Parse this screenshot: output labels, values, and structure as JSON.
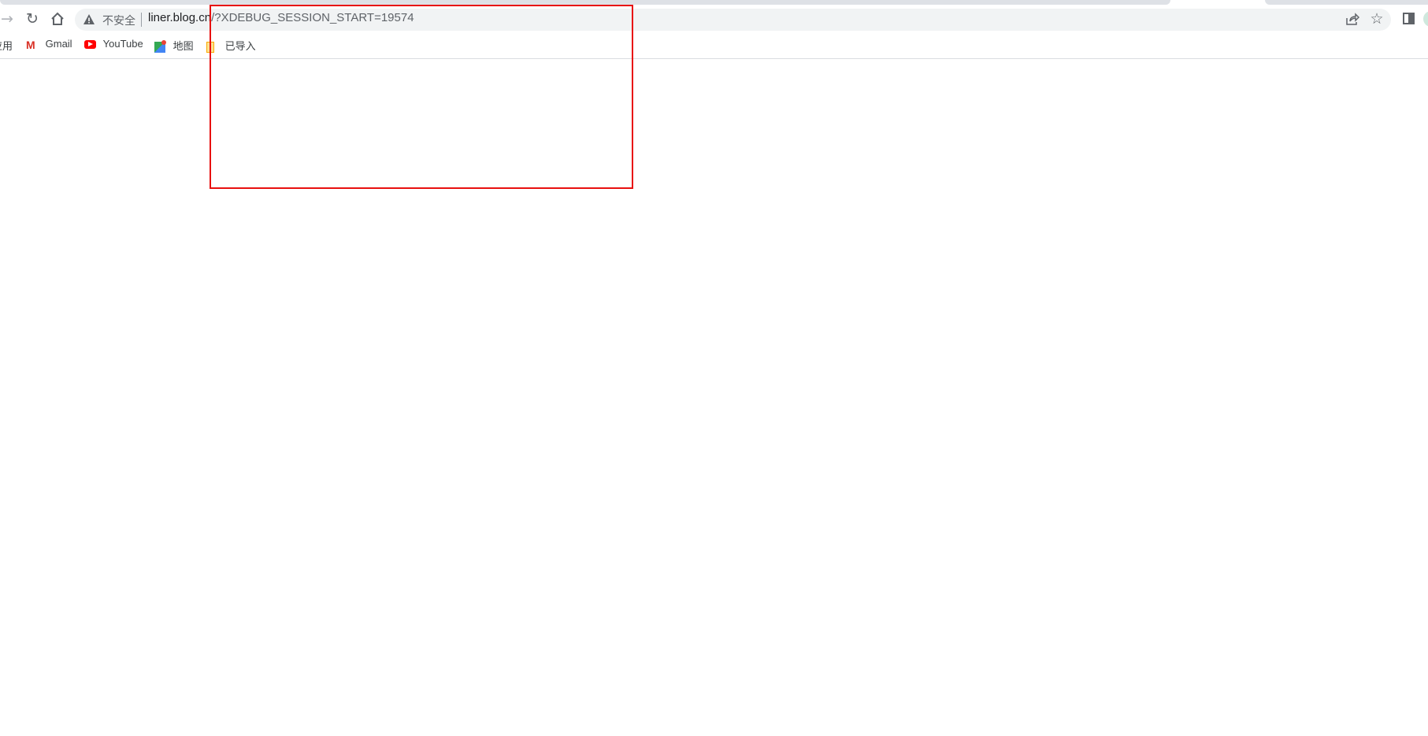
{
  "toolbar": {
    "security_label": "不安全",
    "url_host": "liner.blog.cn",
    "url_path": "/?XDEBUG_SESSION_START=19574",
    "icons": [
      "forward-arrow-icon",
      "reload-icon",
      "home-icon",
      "warning-icon",
      "share-icon",
      "star-icon",
      "side-panel-icon",
      "profile-icon"
    ]
  },
  "bookmarks": [
    {
      "label": "应用",
      "icon": "apps-icon"
    },
    {
      "label": "Gmail",
      "icon": "gmail-icon"
    },
    {
      "label": "YouTube",
      "icon": "youtube-icon"
    },
    {
      "label": "地图",
      "icon": "maps-icon"
    },
    {
      "label": "已导入",
      "icon": "folder-icon"
    }
  ],
  "colors": {
    "highlight": "#e8100f",
    "omnibox": "#f1f3f4"
  }
}
